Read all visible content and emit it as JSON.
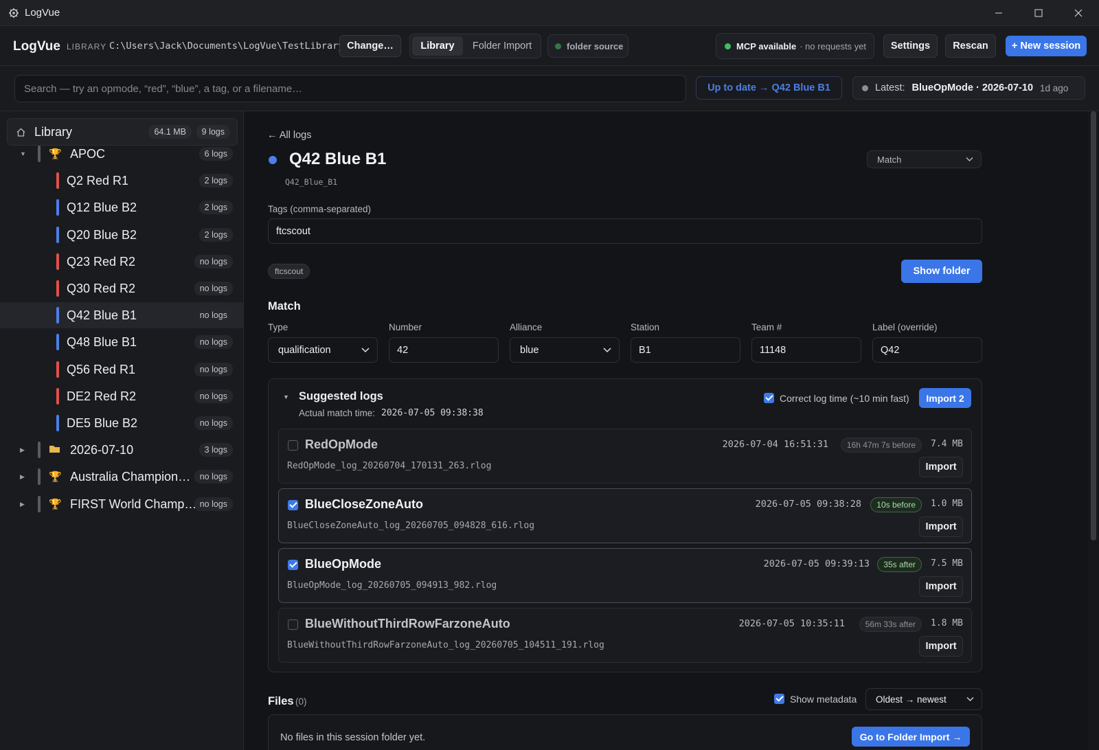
{
  "window": {
    "title": "LogVue"
  },
  "header": {
    "brand": "LogVue",
    "library_label": "LIBRARY",
    "library_path": "C:\\Users\\Jack\\Documents\\LogVue\\TestLibrary",
    "change_button": "Change…",
    "tabs": [
      "Library",
      "Folder Import"
    ],
    "active_tab": "Library",
    "source_status": "folder source",
    "mcp_status": "MCP available",
    "mcp_detail": "· no requests yet",
    "settings_button": "Settings",
    "rescan_button": "Rescan",
    "new_session_button": "+ New session"
  },
  "search": {
    "placeholder": "Search — try an opmode, “red”, “blue”, a tag, or a filename…",
    "uptodate": "Up to date → Q42 Blue B1",
    "latest_label": "Latest:",
    "latest_value": "BlueOpMode · 2026-07-10",
    "latest_ago": "1d ago"
  },
  "sidebar": {
    "library_title": "Library",
    "library_size": "64.1 MB",
    "library_count": "9 logs",
    "tree": [
      {
        "label": "APOC",
        "count": "6 logs",
        "kind": "event",
        "expanded": true
      },
      {
        "label": "Q2 Red R1",
        "count": "2 logs",
        "kind": "match",
        "alliance": "red"
      },
      {
        "label": "Q12 Blue B2",
        "count": "2 logs",
        "kind": "match",
        "alliance": "blue"
      },
      {
        "label": "Q20 Blue B2",
        "count": "2 logs",
        "kind": "match",
        "alliance": "blue"
      },
      {
        "label": "Q23 Red R2",
        "count": "no logs",
        "kind": "match",
        "alliance": "red"
      },
      {
        "label": "Q30 Red R2",
        "count": "no logs",
        "kind": "match",
        "alliance": "red"
      },
      {
        "label": "Q42 Blue B1",
        "count": "no logs",
        "kind": "match",
        "alliance": "blue",
        "selected": true
      },
      {
        "label": "Q48 Blue B1",
        "count": "no logs",
        "kind": "match",
        "alliance": "blue"
      },
      {
        "label": "Q56 Red R1",
        "count": "no logs",
        "kind": "match",
        "alliance": "red"
      },
      {
        "label": "DE2 Red R2",
        "count": "no logs",
        "kind": "match",
        "alliance": "red"
      },
      {
        "label": "DE5 Blue B2",
        "count": "no logs",
        "kind": "match",
        "alliance": "blue"
      },
      {
        "label": "2026-07-10",
        "count": "3 logs",
        "kind": "folder"
      },
      {
        "label": "Australia Champion…",
        "count": "no logs",
        "kind": "event"
      },
      {
        "label": "FIRST World Champ…",
        "count": "no logs",
        "kind": "event"
      }
    ]
  },
  "session": {
    "back_link": "← All logs",
    "title": "Q42 Blue B1",
    "folder_id": "Q42_Blue_B1",
    "kind_select": "Match",
    "tags_label": "Tags (comma-separated)",
    "tags_value": "ftcscout",
    "tag_chip": "ftcscout",
    "show_folder_button": "Show folder",
    "match_heading": "Match",
    "fields": [
      {
        "label": "Type",
        "value": "qualification",
        "kind": "select"
      },
      {
        "label": "Number",
        "value": "42",
        "kind": "input"
      },
      {
        "label": "Alliance",
        "value": "blue",
        "kind": "select"
      },
      {
        "label": "Station",
        "value": "B1",
        "kind": "input"
      },
      {
        "label": "Team #",
        "value": "11148",
        "kind": "input"
      },
      {
        "label": "Label (override)",
        "value": "Q42",
        "kind": "input"
      }
    ]
  },
  "suggested": {
    "title": "Suggested logs",
    "actual_label": "Actual match time:",
    "actual_time": "2026-07-05 09:38:38",
    "correct_label": "Correct log time (~10 min fast)",
    "import_button": "Import 2",
    "logs": [
      {
        "name": "RedOpMode",
        "file": "RedOpMode_log_20260704_170131_263.rlog",
        "time": "2026-07-04 16:51:31",
        "relative": "16h 47m 7s before",
        "size": "7.4 MB",
        "checked": false,
        "import": "Import"
      },
      {
        "name": "BlueCloseZoneAuto",
        "file": "BlueCloseZoneAuto_log_20260705_094828_616.rlog",
        "time": "2026-07-05 09:38:28",
        "relative": "10s before",
        "size": "1.0 MB",
        "checked": true,
        "import": "Import"
      },
      {
        "name": "BlueOpMode",
        "file": "BlueOpMode_log_20260705_094913_982.rlog",
        "time": "2026-07-05 09:39:13",
        "relative": "35s after",
        "size": "7.5 MB",
        "checked": true,
        "import": "Import"
      },
      {
        "name": "BlueWithoutThirdRowFarzoneAuto",
        "file": "BlueWithoutThirdRowFarzoneAuto_log_20260705_104511_191.rlog",
        "time": "2026-07-05 10:35:11",
        "relative": "56m 33s after",
        "size": "1.8 MB",
        "checked": false,
        "import": "Import"
      }
    ]
  },
  "files": {
    "title": "Files",
    "count": "(0)",
    "show_metadata": "Show metadata",
    "sort": "Oldest → newest",
    "empty": "No files in this session folder yet.",
    "goto_button": "Go to Folder Import →"
  },
  "colors": {
    "accent": "#3a76e8",
    "red": "#e0514a",
    "blue": "#4d7fe8",
    "green": "#3fbf5f"
  }
}
